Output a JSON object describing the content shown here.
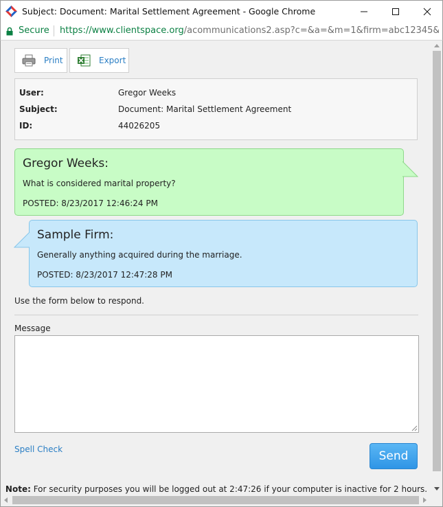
{
  "window": {
    "title": "Subject: Document: Marital Settlement Agreement - Google Chrome"
  },
  "address_bar": {
    "secure_label": "Secure",
    "url_scheme_host": "https://www.clientspace.org",
    "url_path": "/acommunications2.asp?c=&a=&m=1&firm=abc12345&ca..."
  },
  "toolbar": {
    "print_label": "Print",
    "export_label": "Export"
  },
  "info": {
    "user_label": "User:",
    "user_value": "Gregor Weeks",
    "subject_label": "Subject:",
    "subject_value": "Document: Marital Settlement Agreement",
    "id_label": "ID:",
    "id_value": "44026205"
  },
  "messages": [
    {
      "author": "Gregor Weeks:",
      "text": "What is considered marital property?",
      "posted": "POSTED: 8/23/2017 12:46:24 PM"
    },
    {
      "author": "Sample Firm:",
      "text": "Generally anything acquired during the marriage.",
      "posted": "POSTED: 8/23/2017 12:47:28 PM"
    }
  ],
  "form": {
    "hint": "Use the form below to respond.",
    "message_label": "Message",
    "message_value": "",
    "spell_check_label": "Spell Check",
    "send_label": "Send"
  },
  "note": {
    "label": "Note:",
    "text": " For security purposes you will be logged out at 2:47:26 if your computer is inactive for 2 hours."
  },
  "colors": {
    "client_bubble": "#c8fcc6",
    "firm_bubble": "#c7e8fb",
    "link": "#2a7ec4",
    "secure_green": "#0b8043",
    "send_button": "#3a9eea"
  }
}
